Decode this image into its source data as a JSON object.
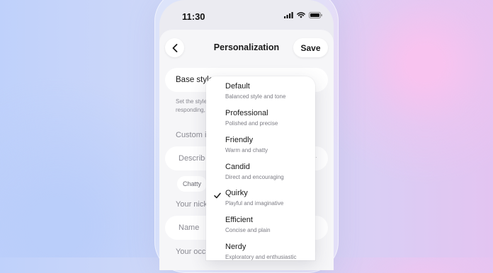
{
  "status_bar": {
    "time": "11:30"
  },
  "header": {
    "title": "Personalization",
    "save_label": "Save"
  },
  "base_style": {
    "label": "Base style"
  },
  "hint_text": {
    "line1": "Set the style",
    "line2": "responding,"
  },
  "sections": {
    "custom_instructions_label": "Custom i",
    "describe_placeholder": "Describe",
    "chip_label": "Chatty",
    "nickname_label": "Your nick",
    "name_placeholder": "Name",
    "occupation_label": "Your occu"
  },
  "dropdown": {
    "selected": "Quirky",
    "options": [
      {
        "label": "Default",
        "description": "Balanced style and tone"
      },
      {
        "label": "Professional",
        "description": "Polished and precise"
      },
      {
        "label": "Friendly",
        "description": "Warm and chatty"
      },
      {
        "label": "Candid",
        "description": "Direct and encouraging"
      },
      {
        "label": "Quirky",
        "description": "Playful and imaginative"
      },
      {
        "label": "Efficient",
        "description": "Concise and plain"
      },
      {
        "label": "Nerdy",
        "description": "Exploratory and enthusiastic"
      }
    ]
  },
  "colors": {
    "background_left": "#bfd1fb",
    "background_right": "#e3c4f1",
    "accent_pink": "#f8c3ef",
    "sheet": "#f6f6f8",
    "text_primary": "#1a1a1a",
    "text_secondary": "#8a8a92"
  },
  "icons": [
    "signal-icon",
    "wifi-icon",
    "battery-icon",
    "back-chevron-icon",
    "checkmark-icon"
  ]
}
